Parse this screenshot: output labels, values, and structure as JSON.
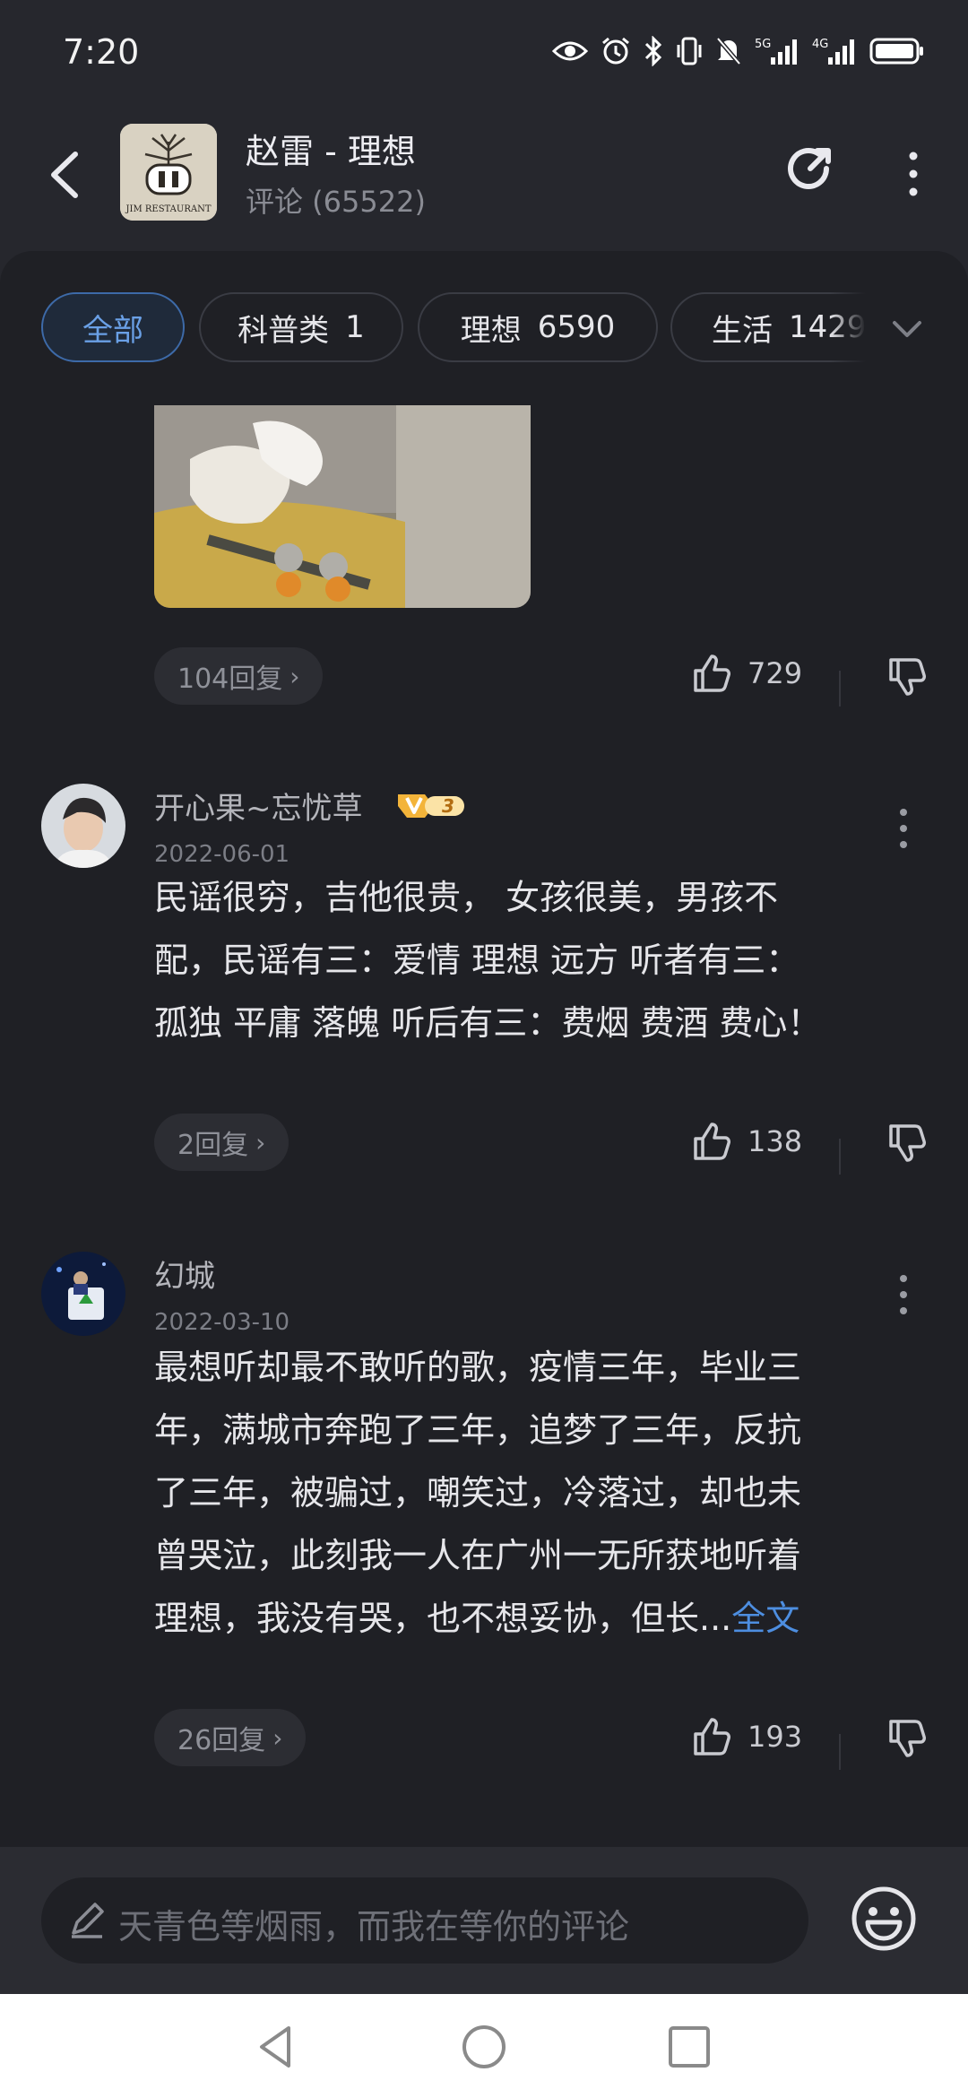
{
  "status_bar": {
    "time": "7:20",
    "icons": [
      "eye-icon",
      "alarm-icon",
      "bluetooth-icon",
      "vibrate-icon",
      "mute-icon",
      "5g-signal-icon",
      "4g-signal-icon",
      "battery-icon"
    ],
    "signal_labels": [
      "5G",
      "4G"
    ]
  },
  "header": {
    "title": "赵雷 - 理想",
    "subtitle": "评论 (65522)",
    "album_text": "JIM RESTAURANT"
  },
  "tabs": [
    {
      "label": "全部",
      "count": ""
    },
    {
      "label": "科普类",
      "count": "1"
    },
    {
      "label": "理想",
      "count": "6590"
    },
    {
      "label": "生活",
      "count": "1429"
    }
  ],
  "comments": [
    {
      "replies": "104回复",
      "likes": "729"
    },
    {
      "user": "开心果~忘忧草",
      "vip_level": "3",
      "date": "2022-06-01",
      "lines": [
        "民谣很穷，吉他很贵， 女孩很美，男孩不",
        "配，民谣有三：爱情 理想 远方 听者有三：",
        "孤独 平庸 落魄 听后有三：费烟 费酒 费心！"
      ],
      "replies": "2回复",
      "likes": "138"
    },
    {
      "user": "幻城",
      "date": "2022-03-10",
      "lines": [
        "最想听却最不敢听的歌，疫情三年，毕业三",
        "年，满城市奔跑了三年，追梦了三年，反抗",
        "了三年，被骗过，嘲笑过，冷落过，却也未",
        "曾哭泣，此刻我一人在广州一无所获地听着",
        "理想，我没有哭，也不想妥协，但长..."
      ],
      "more": "全文",
      "replies": "26回复",
      "likes": "193"
    }
  ],
  "input": {
    "placeholder": "天青色等烟雨，而我在等你的评论"
  },
  "colors": {
    "background": "#1f2025",
    "accent": "#4d8ee0",
    "vip": "#f3b43a"
  }
}
